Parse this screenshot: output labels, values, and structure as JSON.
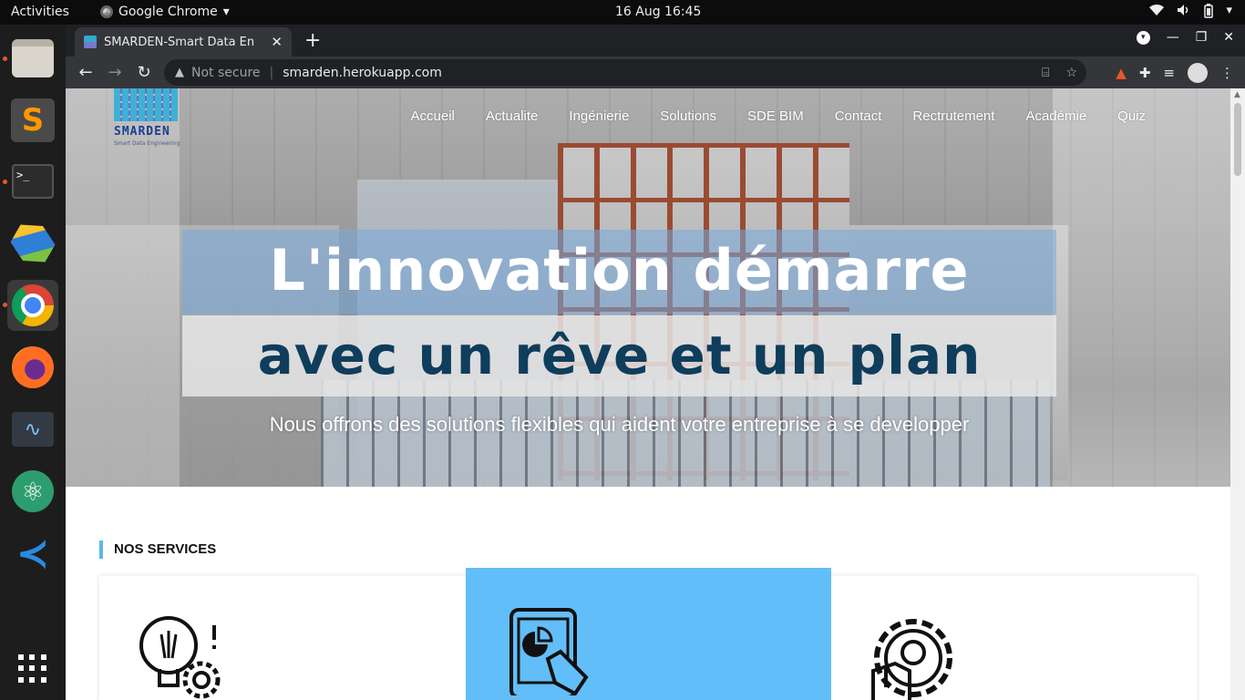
{
  "topbar": {
    "activities": "Activities",
    "app_name": "Google Chrome",
    "clock": "16 Aug  16:45"
  },
  "dock": {
    "items": [
      "files",
      "sublime-text",
      "terminal",
      "cube-app",
      "google-chrome",
      "firefox",
      "system-monitor",
      "atom",
      "vscode",
      "show-applications"
    ]
  },
  "browser": {
    "tab_title": "SMARDEN-Smart Data En",
    "security_label": "Not secure",
    "url": "smarden.herokuapp.com"
  },
  "site": {
    "logo_word": "SMARDEN",
    "logo_tagline": "Smart Data Engineering",
    "nav": [
      "Accueil",
      "Actualite",
      "Ingénierie",
      "Solutions",
      "SDE BIM",
      "Contact",
      "Rectrutement",
      "Académie",
      "Quiz"
    ],
    "headline_1": "L'innovation démarre",
    "headline_2": "avec un rêve et un plan",
    "subline": "Nous offrons des solutions flexibles qui aident votre entreprise à se developper",
    "services_title": "NOS SERVICES",
    "services": [
      {
        "icon": "lightbulb-gear-icon"
      },
      {
        "icon": "tablet-chart-touch-icon",
        "highlight_color": "#62bef8"
      },
      {
        "icon": "gear-box-icon"
      }
    ]
  },
  "colors": {
    "accent_blue": "#5cb7ef",
    "headline_dark": "#0f3d5c"
  }
}
